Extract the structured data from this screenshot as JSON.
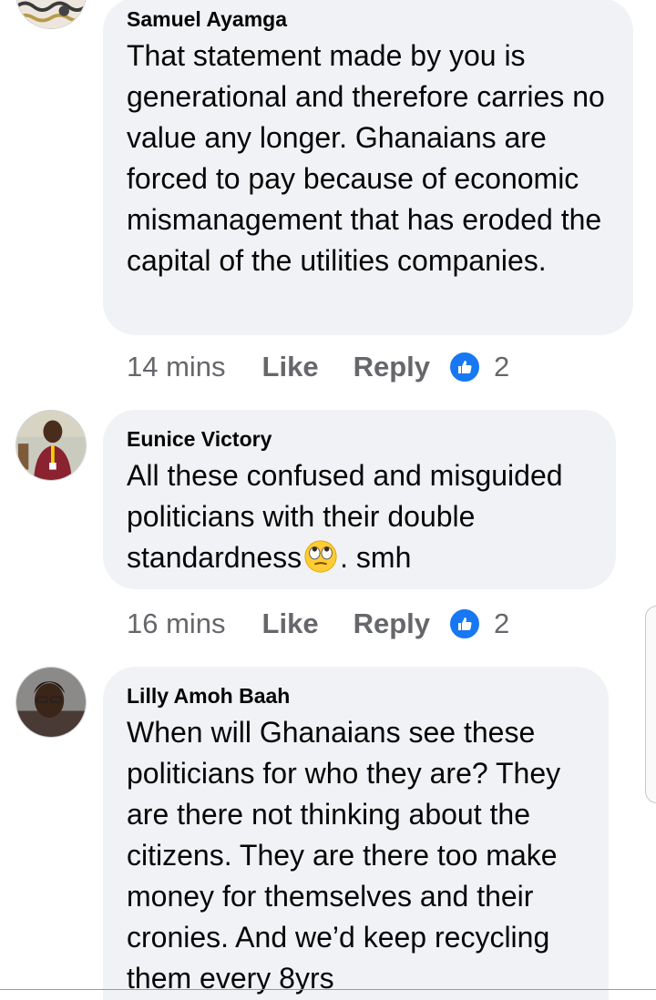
{
  "comments": [
    {
      "author": "Samuel Ayamga",
      "text": "That statement made by you is generational and therefore carries no value any longer. Ghanaians are forced to pay because of economic mismanagement that has eroded the capital of the utilities companies.",
      "time": "14 mins",
      "like_label": "Like",
      "reply_label": "Reply",
      "reaction_icon": "like-icon",
      "reaction_count": "2"
    },
    {
      "author": "Eunice Victory",
      "text_before_emoji": "All these confused and misguided politicians with their double standardness",
      "emoji": "face-with-rolling-eyes-emoji",
      "text_after_emoji": ". smh",
      "time": "16 mins",
      "like_label": "Like",
      "reply_label": "Reply",
      "reaction_icon": "like-icon",
      "reaction_count": "2"
    },
    {
      "author": "Lilly Amoh Baah",
      "text": "When will Ghanaians see these politicians for who they are? They are there not thinking about the citizens. They are there too make money for themselves and their cronies. And we’d keep recycling them every 8yrs"
    }
  ],
  "colors": {
    "bubble": "#f0f2f5",
    "meta_text": "#65676b",
    "reaction_blue": "#1877f2"
  }
}
